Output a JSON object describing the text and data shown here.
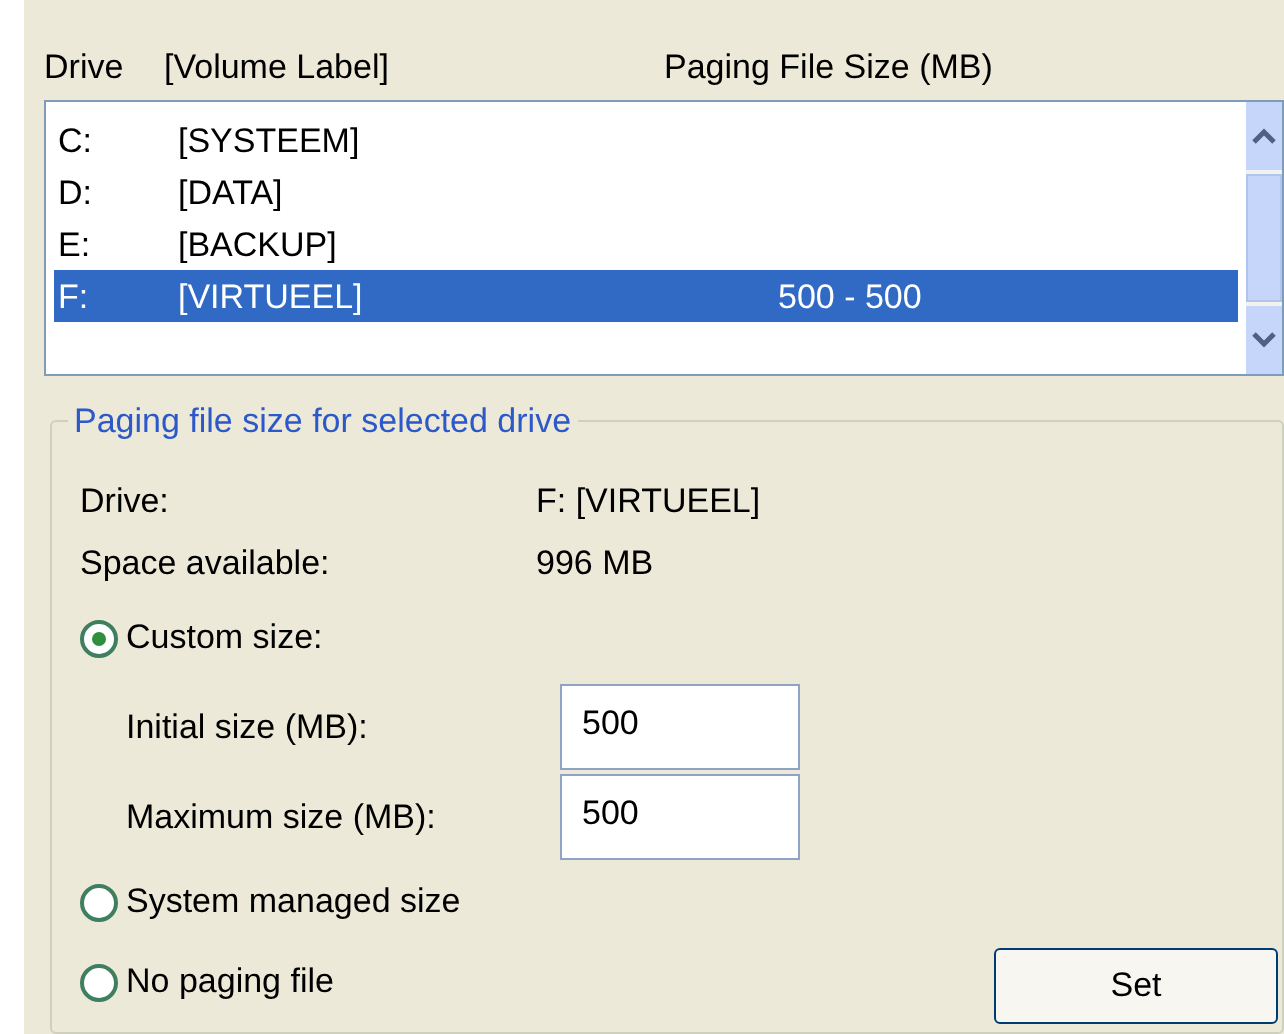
{
  "list_header": {
    "drive": "Drive",
    "volume_label": "[Volume Label]",
    "paging_size": "Paging File Size (MB)"
  },
  "drives": [
    {
      "drive": "C:",
      "label": "[SYSTEEM]",
      "selected": false
    },
    {
      "drive": "D:",
      "label": "[DATA]",
      "selected": false
    },
    {
      "drive": "E:",
      "label": "[BACKUP]",
      "selected": false
    },
    {
      "drive": "F:",
      "label": "[VIRTUEEL]",
      "size": "500 - 500",
      "selected": true
    }
  ],
  "group": {
    "title": "Paging file size for selected drive",
    "info": [
      {
        "label": "Drive:",
        "value": "F: [VIRTUEEL]"
      },
      {
        "label": "Space available:",
        "value": "996 MB"
      }
    ],
    "options": [
      {
        "label": "Custom size:",
        "selected": true,
        "fields": [
          {
            "label": "Initial size (MB):",
            "value": "500"
          },
          {
            "label": "Maximum size (MB):",
            "value": "500"
          }
        ]
      },
      {
        "label": "System managed size",
        "selected": false
      },
      {
        "label": "No paging file",
        "selected": false
      }
    ],
    "button": "Set"
  }
}
